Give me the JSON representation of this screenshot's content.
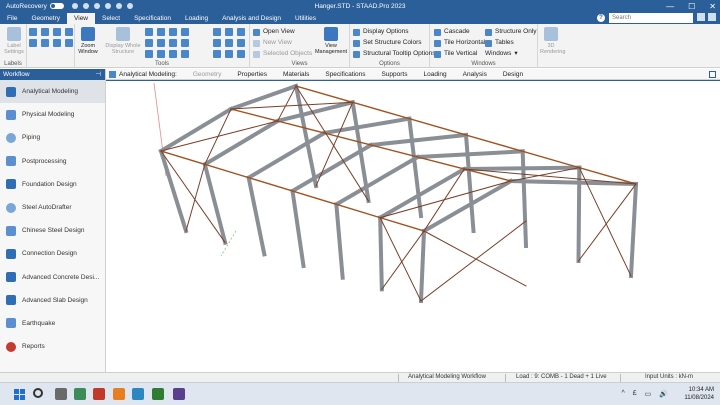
{
  "titlebar": {
    "autorecovery_label": "AutoRecovery",
    "toggle_state": "Off",
    "window_title": "Hanger.STD - STAAD.Pro 2023",
    "minimize": "—",
    "maximize": "☐",
    "close": "✕"
  },
  "ribbon_tabs": [
    "File",
    "Geometry",
    "View",
    "Select",
    "Specification",
    "Loading",
    "Analysis and Design",
    "Utilities"
  ],
  "active_tab": "View",
  "search": {
    "placeholder": "Search"
  },
  "help_glyph": "?",
  "ribbon": {
    "labels_group": {
      "button": "Label Settings",
      "label": "Labels"
    },
    "tools_group": {
      "zoom": "Zoom Window",
      "display": "Display Whole Structure",
      "label": "Tools"
    },
    "views_group": {
      "open_view": "Open View",
      "new_view": "New View",
      "selected_objects": "Selected Objects",
      "view_management": "View Management",
      "label": "Views"
    },
    "options_group": {
      "display_options": "Display Options",
      "set_structure_colors": "Set Structure Colors",
      "tooltip_options": "Structural Tooltip Options",
      "label": "Options"
    },
    "windows_group": {
      "cascade": "Cascade",
      "tile_horizontal": "Tile Horizontal",
      "tile_vertical": "Tile Vertical",
      "structure_only": "Structure Only",
      "tables": "Tables",
      "windows": "Windows",
      "label": "Windows"
    },
    "rendering": {
      "label": "3D Rendering"
    }
  },
  "workflow": {
    "title": "Workflow",
    "pin": "📌",
    "items": [
      "Analytical Modeling",
      "Physical Modeling",
      "Piping",
      "Postprocessing",
      "Foundation Design",
      "Steel AutoDrafter",
      "Chinese Steel Design",
      "Connection Design",
      "Advanced Concrete Desi...",
      "Advanced Slab Design",
      "Earthquake",
      "Reports"
    ],
    "active_index": 0
  },
  "page_control": {
    "current": "Analytical Modeling:",
    "pages": [
      "Geometry",
      "Properties",
      "Materials",
      "Specifications",
      "Supports",
      "Loading",
      "Analysis",
      "Design"
    ],
    "dimmed_page": "Geometry"
  },
  "statusbar": {
    "workflow": "Analytical Modeling Workflow",
    "load": "Load : 9: COMB - 1 Dead + 1 Live",
    "units": "Input Units : kN-m"
  },
  "taskbar": {
    "time": "10:34 AM",
    "date": "11/08/2024",
    "tray_symbols": [
      "^",
      "£",
      "▭",
      "🔊"
    ]
  },
  "colors": {
    "brand_blue": "#2b5f99",
    "steel_member": "#8a8f96",
    "beam_orange": "#a0521e",
    "bracing": "#7b3f2a"
  }
}
